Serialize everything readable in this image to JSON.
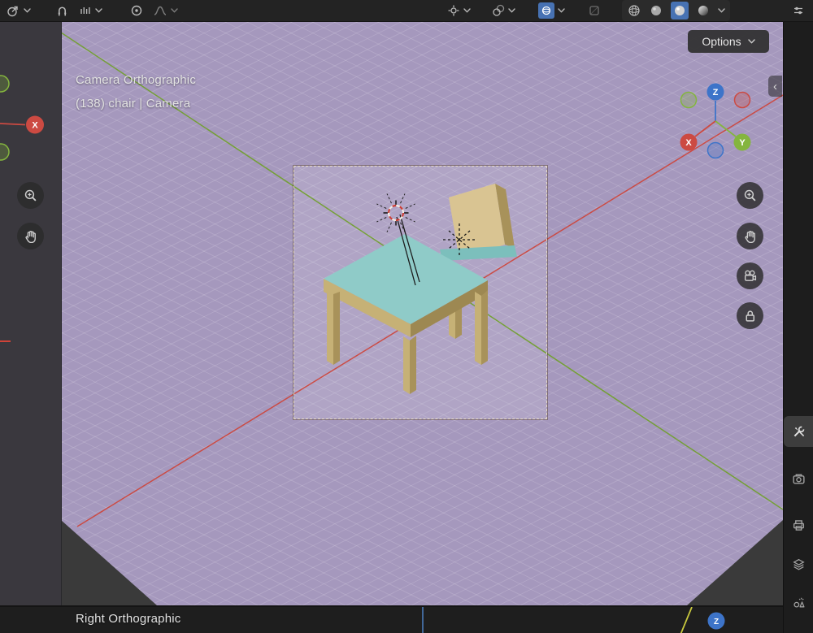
{
  "header": {
    "options_button_label": "Options",
    "left_icon_names": [
      "proportional-edit-icon",
      "dropdown-chevron",
      "snap-magnet-icon",
      "snap-increment-icon",
      "dropdown-chevron",
      "proportional-radius-icon",
      "falloff-curve-icon",
      "dropdown-chevron"
    ],
    "right_icon_names": [
      "gizmo-icon",
      "dropdown-chevron",
      "overlays-icon",
      "dropdown-chevron",
      "xray-toggle-icon",
      "dropdown-chevron",
      "box-icon",
      "wireframe-shading-icon",
      "solid-shading-icon",
      "material-shading-icon",
      "rendered-shading-icon",
      "dropdown-chevron"
    ]
  },
  "main_viewport": {
    "overlay_line1": "Camera Orthographic",
    "overlay_line2": "(138) chair | Camera",
    "sidebar_toggle_glyph": "‹",
    "nav_gizmo": {
      "x_label": "X",
      "y_label": "Y",
      "z_label": "Z"
    },
    "nav_button_icons": [
      "zoom-icon",
      "hand-icon",
      "camera-icon",
      "lock-icon"
    ]
  },
  "left_viewport": {
    "gizmo_x_label": "X",
    "nav_button_icons": [
      "zoom-icon",
      "hand-icon"
    ]
  },
  "bottom_viewport": {
    "overlay_text": "Right Orthographic",
    "gizmo_z_label": "Z"
  },
  "properties_panel": {
    "tab_icon_names": [
      "tool-icon",
      "render-icon",
      "output-icon",
      "view-layer-icon",
      "scene-icon"
    ]
  },
  "colors": {
    "viewport_floor": "#a598bd",
    "camera_highlight": "#b7aacc",
    "axis_x": "#cf4338",
    "axis_y": "#6fa028",
    "axis_z": "#3d74c9",
    "selection_blue": "#4772b3",
    "wood_light": "#d9c492",
    "wood_shadow": "#a8925a",
    "seat_teal": "#8fcbc8",
    "panel_dark": "#232323"
  }
}
